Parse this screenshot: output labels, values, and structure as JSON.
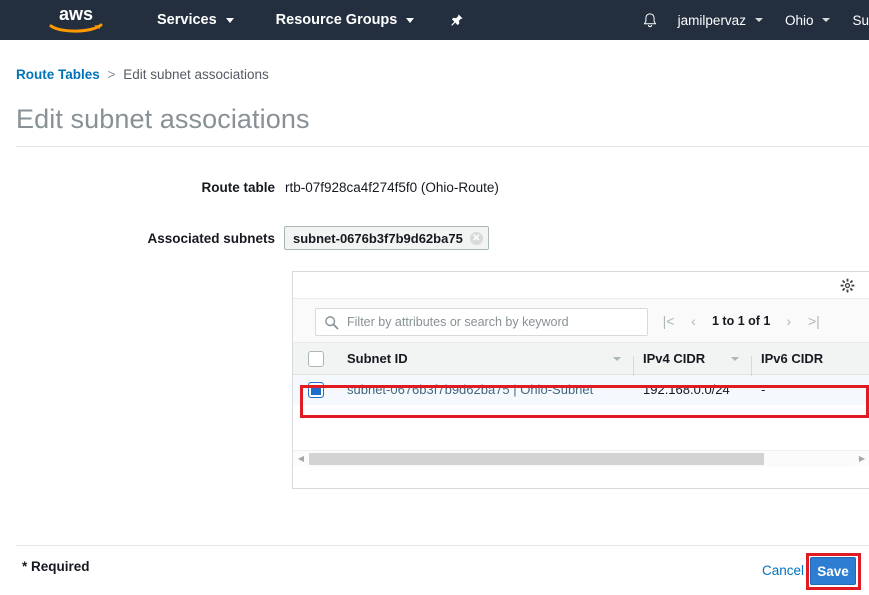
{
  "nav": {
    "logo_alt": "aws",
    "services_label": "Services",
    "resource_groups_label": "Resource Groups",
    "pin_icon": "pushpin-icon",
    "bell_icon": "notification-bell-icon",
    "user_label": "jamilpervaz",
    "region_label": "Ohio",
    "support_label": "Su",
    "bg_color": "#232f3e"
  },
  "breadcrumb": {
    "parent": "Route Tables",
    "separator": ">",
    "current": "Edit subnet associations",
    "link_color": "#0073bb"
  },
  "page": {
    "title": "Edit subnet associations"
  },
  "form": {
    "route_table_label": "Route table",
    "route_table_value": "rtb-07f928ca4f274f5f0 (Ohio-Route)",
    "associated_subnets_label": "Associated subnets",
    "token_value": "subnet-0676b3f7b9d62ba75",
    "token_remove_icon": "close-icon"
  },
  "table_panel": {
    "gear_icon": "gear-icon",
    "search": {
      "icon": "search-icon",
      "placeholder": "Filter by attributes or search by keyword",
      "value": ""
    },
    "pagination": {
      "first_icon": "|<",
      "prev_icon": "‹",
      "count_text": "1 to 1 of 1",
      "next_icon": "›",
      "last_icon": ">|"
    },
    "columns": [
      "Subnet ID",
      "IPv4 CIDR",
      "IPv6 CIDR"
    ],
    "rows": [
      {
        "selected": true,
        "subnet_id": "subnet-0676b3f7b9d62ba75 | Ohio-Subnet",
        "ipv4_cidr": "192.168.0.0/24",
        "ipv6_cidr": "-"
      }
    ],
    "row_highlight_color": "#f5f9fd",
    "annotation_color": "#e01b24"
  },
  "footer": {
    "required_text": "* Required",
    "cancel_label": "Cancel",
    "save_label": "Save",
    "save_color": "#2d7dd2",
    "annotation_color": "#e01b24"
  }
}
